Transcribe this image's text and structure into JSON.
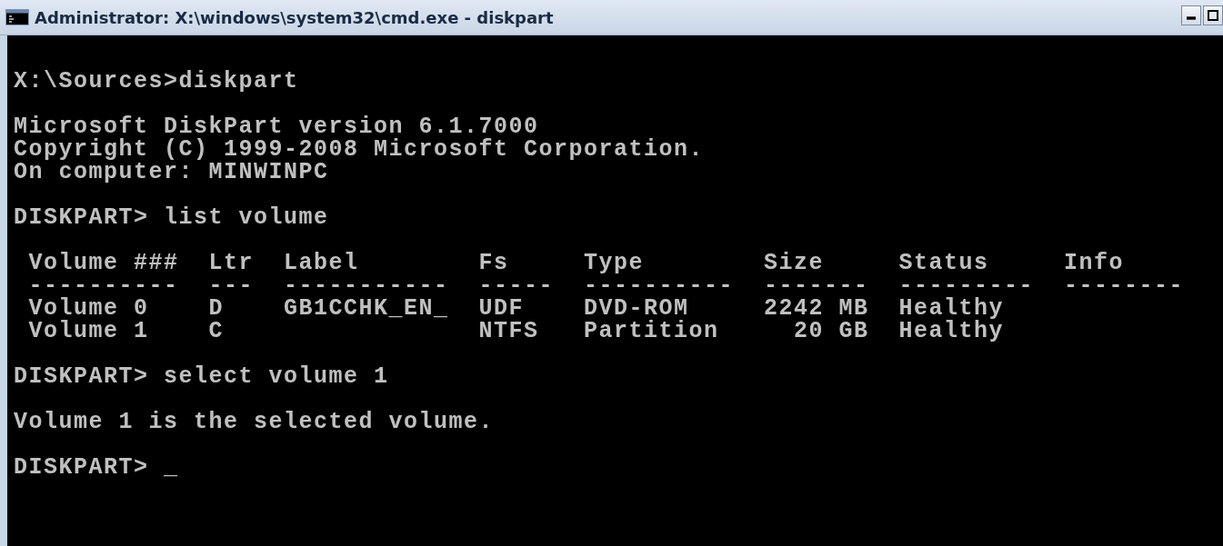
{
  "window": {
    "title": "Administrator: X:\\windows\\system32\\cmd.exe - diskpart"
  },
  "console": [
    {
      "kind": "line",
      "text": "X:\\Sources>diskpart"
    },
    {
      "kind": "blank"
    },
    {
      "kind": "line",
      "text": "Microsoft DiskPart version 6.1.7000"
    },
    {
      "kind": "line",
      "text": "Copyright (C) 1999-2008 Microsoft Corporation."
    },
    {
      "kind": "line",
      "text": "On computer: MINWINPC"
    },
    {
      "kind": "blank"
    },
    {
      "kind": "line",
      "text": "DISKPART> list volume"
    },
    {
      "kind": "blank"
    },
    {
      "kind": "table",
      "columns": [
        {
          "header": "Volume ###",
          "rule": "----------",
          "kind": "text"
        },
        {
          "header": "Ltr",
          "rule": "---",
          "kind": "text"
        },
        {
          "header": "Label",
          "rule": "-----------",
          "kind": "text"
        },
        {
          "header": "Fs",
          "rule": "-----",
          "kind": "text"
        },
        {
          "header": "Type",
          "rule": "----------",
          "kind": "text"
        },
        {
          "header": "Size",
          "rule": "-------",
          "kind": "number"
        },
        {
          "header": "Status",
          "rule": "---------",
          "kind": "text"
        },
        {
          "header": "Info",
          "rule": "--------",
          "kind": "text"
        }
      ],
      "rows": [
        [
          "Volume 0",
          "D",
          "GB1CCHK_EN_",
          "UDF",
          "DVD-ROM",
          "2242 MB",
          "Healthy",
          ""
        ],
        [
          "Volume 1",
          "C",
          "",
          "NTFS",
          "Partition",
          "20 GB",
          "Healthy",
          ""
        ]
      ]
    },
    {
      "kind": "blank"
    },
    {
      "kind": "line",
      "text": "DISKPART> select volume 1"
    },
    {
      "kind": "blank"
    },
    {
      "kind": "line",
      "text": "Volume 1 is the selected volume."
    },
    {
      "kind": "blank"
    },
    {
      "kind": "line",
      "text": "DISKPART> _"
    }
  ]
}
